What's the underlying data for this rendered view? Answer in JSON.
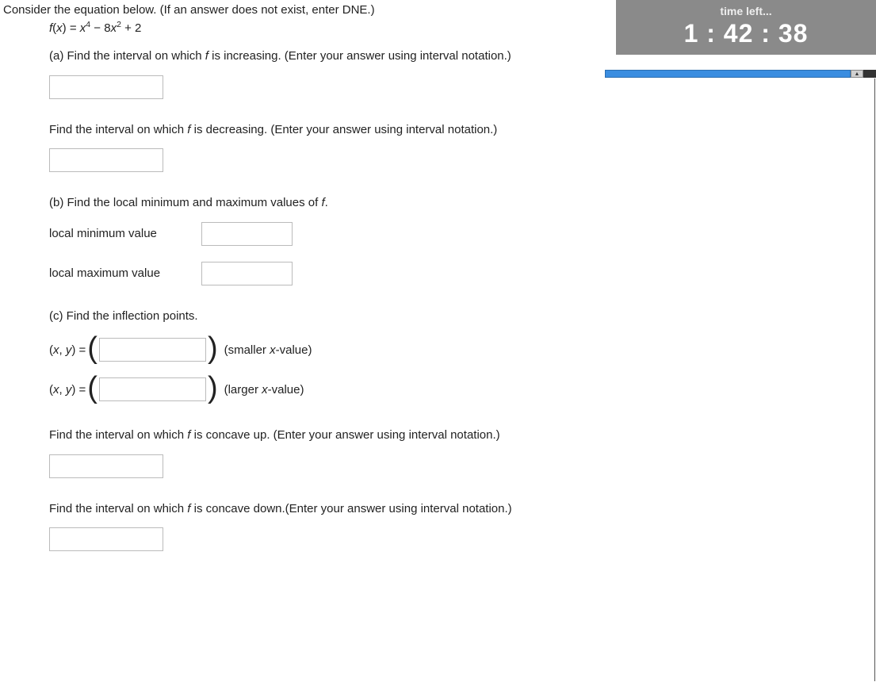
{
  "timer": {
    "label": "time left...",
    "value": "1 : 42 : 38"
  },
  "intro": "Consider the equation below. (If an answer does not exist, enter DNE.)",
  "equation": {
    "lhs_f": "f",
    "lhs_x": "x",
    "eq": " = ",
    "x1": "x",
    "p1": "4",
    "m1": " − 8",
    "x2": "x",
    "p2": "2",
    "m2": " + 2"
  },
  "partA": {
    "incr_prompt_pre": "(a) Find the interval on which ",
    "incr_prompt_f": "f",
    "incr_prompt_post": " is increasing. (Enter your answer using interval notation.)",
    "decr_prompt_pre": "Find the interval on which ",
    "decr_prompt_f": "f",
    "decr_prompt_post": " is decreasing. (Enter your answer using interval notation.)"
  },
  "partB": {
    "prompt_pre": "(b) Find the local minimum and maximum values of ",
    "prompt_f": "f",
    "prompt_post": ".",
    "local_min_label": "local minimum value",
    "local_max_label": "local maximum value"
  },
  "partC": {
    "prompt": "(c) Find the inflection points.",
    "xy_pre_open": "(",
    "xy_x": "x",
    "xy_comma": ", ",
    "xy_y": "y",
    "xy_close": ")",
    "xy_eq": " = ",
    "smaller_post_pre": "(smaller ",
    "smaller_post_x": "x",
    "smaller_post_post": "-value)",
    "larger_post_pre": "(larger ",
    "larger_post_x": "x",
    "larger_post_post": "-value)",
    "concave_up_pre": "Find the interval on which ",
    "concave_up_f": "f",
    "concave_up_post": " is concave up. (Enter your answer using interval notation.)",
    "concave_down_pre": "Find the interval on which ",
    "concave_down_f": "f",
    "concave_down_post": " is concave down.(Enter your answer using interval notation.)"
  }
}
